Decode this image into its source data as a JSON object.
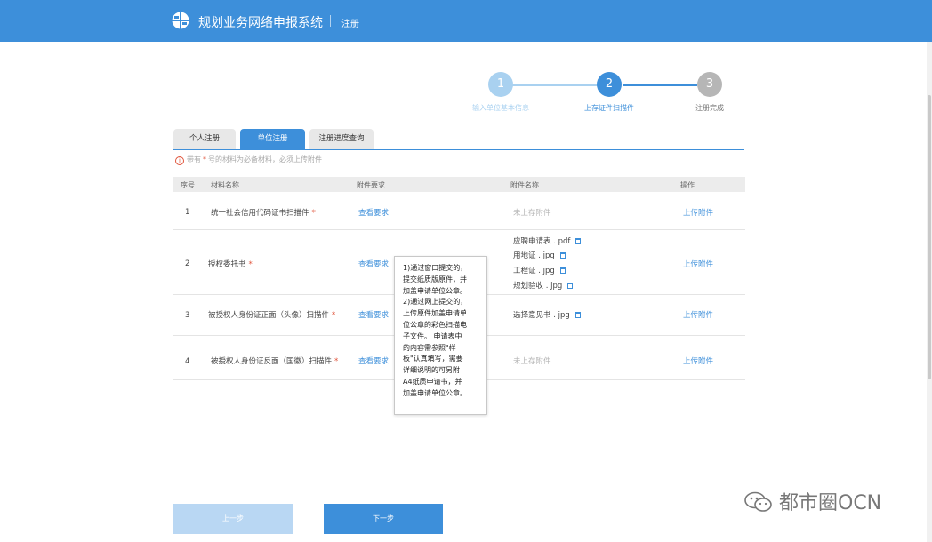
{
  "header": {
    "app_title": "规划业务网络申报系统",
    "page_name": "注册"
  },
  "steps": [
    {
      "number": "1",
      "label": "输入单位基本信息",
      "state": "done"
    },
    {
      "number": "2",
      "label": "上存证件扫描件",
      "state": "active"
    },
    {
      "number": "3",
      "label": "注册完成",
      "state": "pending"
    }
  ],
  "tabs": [
    "个人注册",
    "单位注册",
    "注册进度查询"
  ],
  "notice": {
    "icon": "i",
    "prefix": "带有",
    "star": "*",
    "suffix": "号的材料为必备材料，必须上传附件"
  },
  "table": {
    "columns": [
      "序号",
      "材料名称",
      "附件要求",
      "附件名称",
      "操作"
    ],
    "rows": [
      {
        "index": "1",
        "name": "统一社会信用代码证书扫描件",
        "required": "*",
        "requirement": "查看要求",
        "attachments": [
          "未上存附件"
        ],
        "action": "上传附件"
      },
      {
        "index": "2",
        "name": "授权委托书",
        "required": "*",
        "requirement": "查看要求",
        "attachments": [
          "应聘申请表 . pdf",
          "用地证 . jpg",
          "工程证 . jpg",
          "规划验收 . jpg"
        ],
        "action": "上传附件"
      },
      {
        "index": "3",
        "name": "被授权人身份证正面（头像）扫描件",
        "required": "*",
        "requirement": "查看要求",
        "attachments": [
          "选择意见书 . jpg"
        ],
        "action": "上传附件"
      },
      {
        "index": "4",
        "name": "被授权人身份证反面（国徽）扫描件",
        "required": "*",
        "requirement": "查看要求",
        "attachments": [
          "未上存附件"
        ],
        "action": "上传附件"
      }
    ]
  },
  "tooltip": {
    "lines": [
      "1)通过窗口提交的，",
      "提交纸质版原件，并",
      "加盖申请单位公章。",
      "2)通过网上提交的，",
      "上传原件加盖申请单",
      "位公章的彩色扫描电",
      "子文件。 申请表中",
      "的内容需参照\"样",
      "板\"认真填写，需要",
      "详细说明的可另附",
      "A4纸质申请书，并",
      "加盖申请单位公章。"
    ]
  },
  "buttons": {
    "prev": "上一步",
    "next": "下一步"
  },
  "watermark": "都市圈OCN",
  "colors": {
    "primary": "#3d8fda",
    "done": "#a9d1f0",
    "pending": "#b6b6b6",
    "required": "#e0533a"
  }
}
